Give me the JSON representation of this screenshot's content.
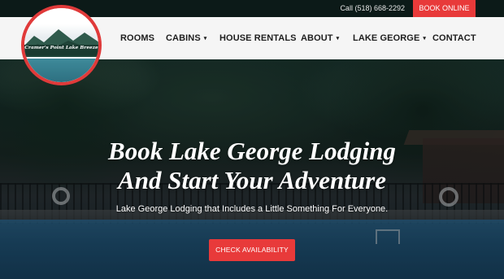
{
  "topbar": {
    "phone": "Call (518) 668-2292",
    "book_online": "BOOK ONLINE"
  },
  "logo": {
    "text": "Cramer's Point Lake Breeze",
    "ring_color": "#e03a3a"
  },
  "nav": {
    "items": [
      {
        "label": "ROOMS",
        "dropdown": false
      },
      {
        "label": "CABINS",
        "dropdown": true
      },
      {
        "label": "HOUSE RENTALS",
        "dropdown": false
      },
      {
        "label": "ABOUT",
        "dropdown": true
      },
      {
        "label": "LAKE GEORGE",
        "dropdown": true
      },
      {
        "label": "CONTACT",
        "dropdown": false
      }
    ],
    "dropdown_icon": "chevron-down-icon",
    "caret": "▾"
  },
  "hero": {
    "headline_line1": "Book Lake George Lodging",
    "headline_line2": "And Start Your Adventure",
    "subline": "Lake George Lodging that Includes a Little Something For Everyone.",
    "cta": "CHECK AVAILABILITY"
  },
  "colors": {
    "accent": "#e83a3a",
    "nav_bg": "#f5f5f5",
    "topbar_bg": "#0c1a18",
    "nav_text": "#1e1e1e"
  }
}
